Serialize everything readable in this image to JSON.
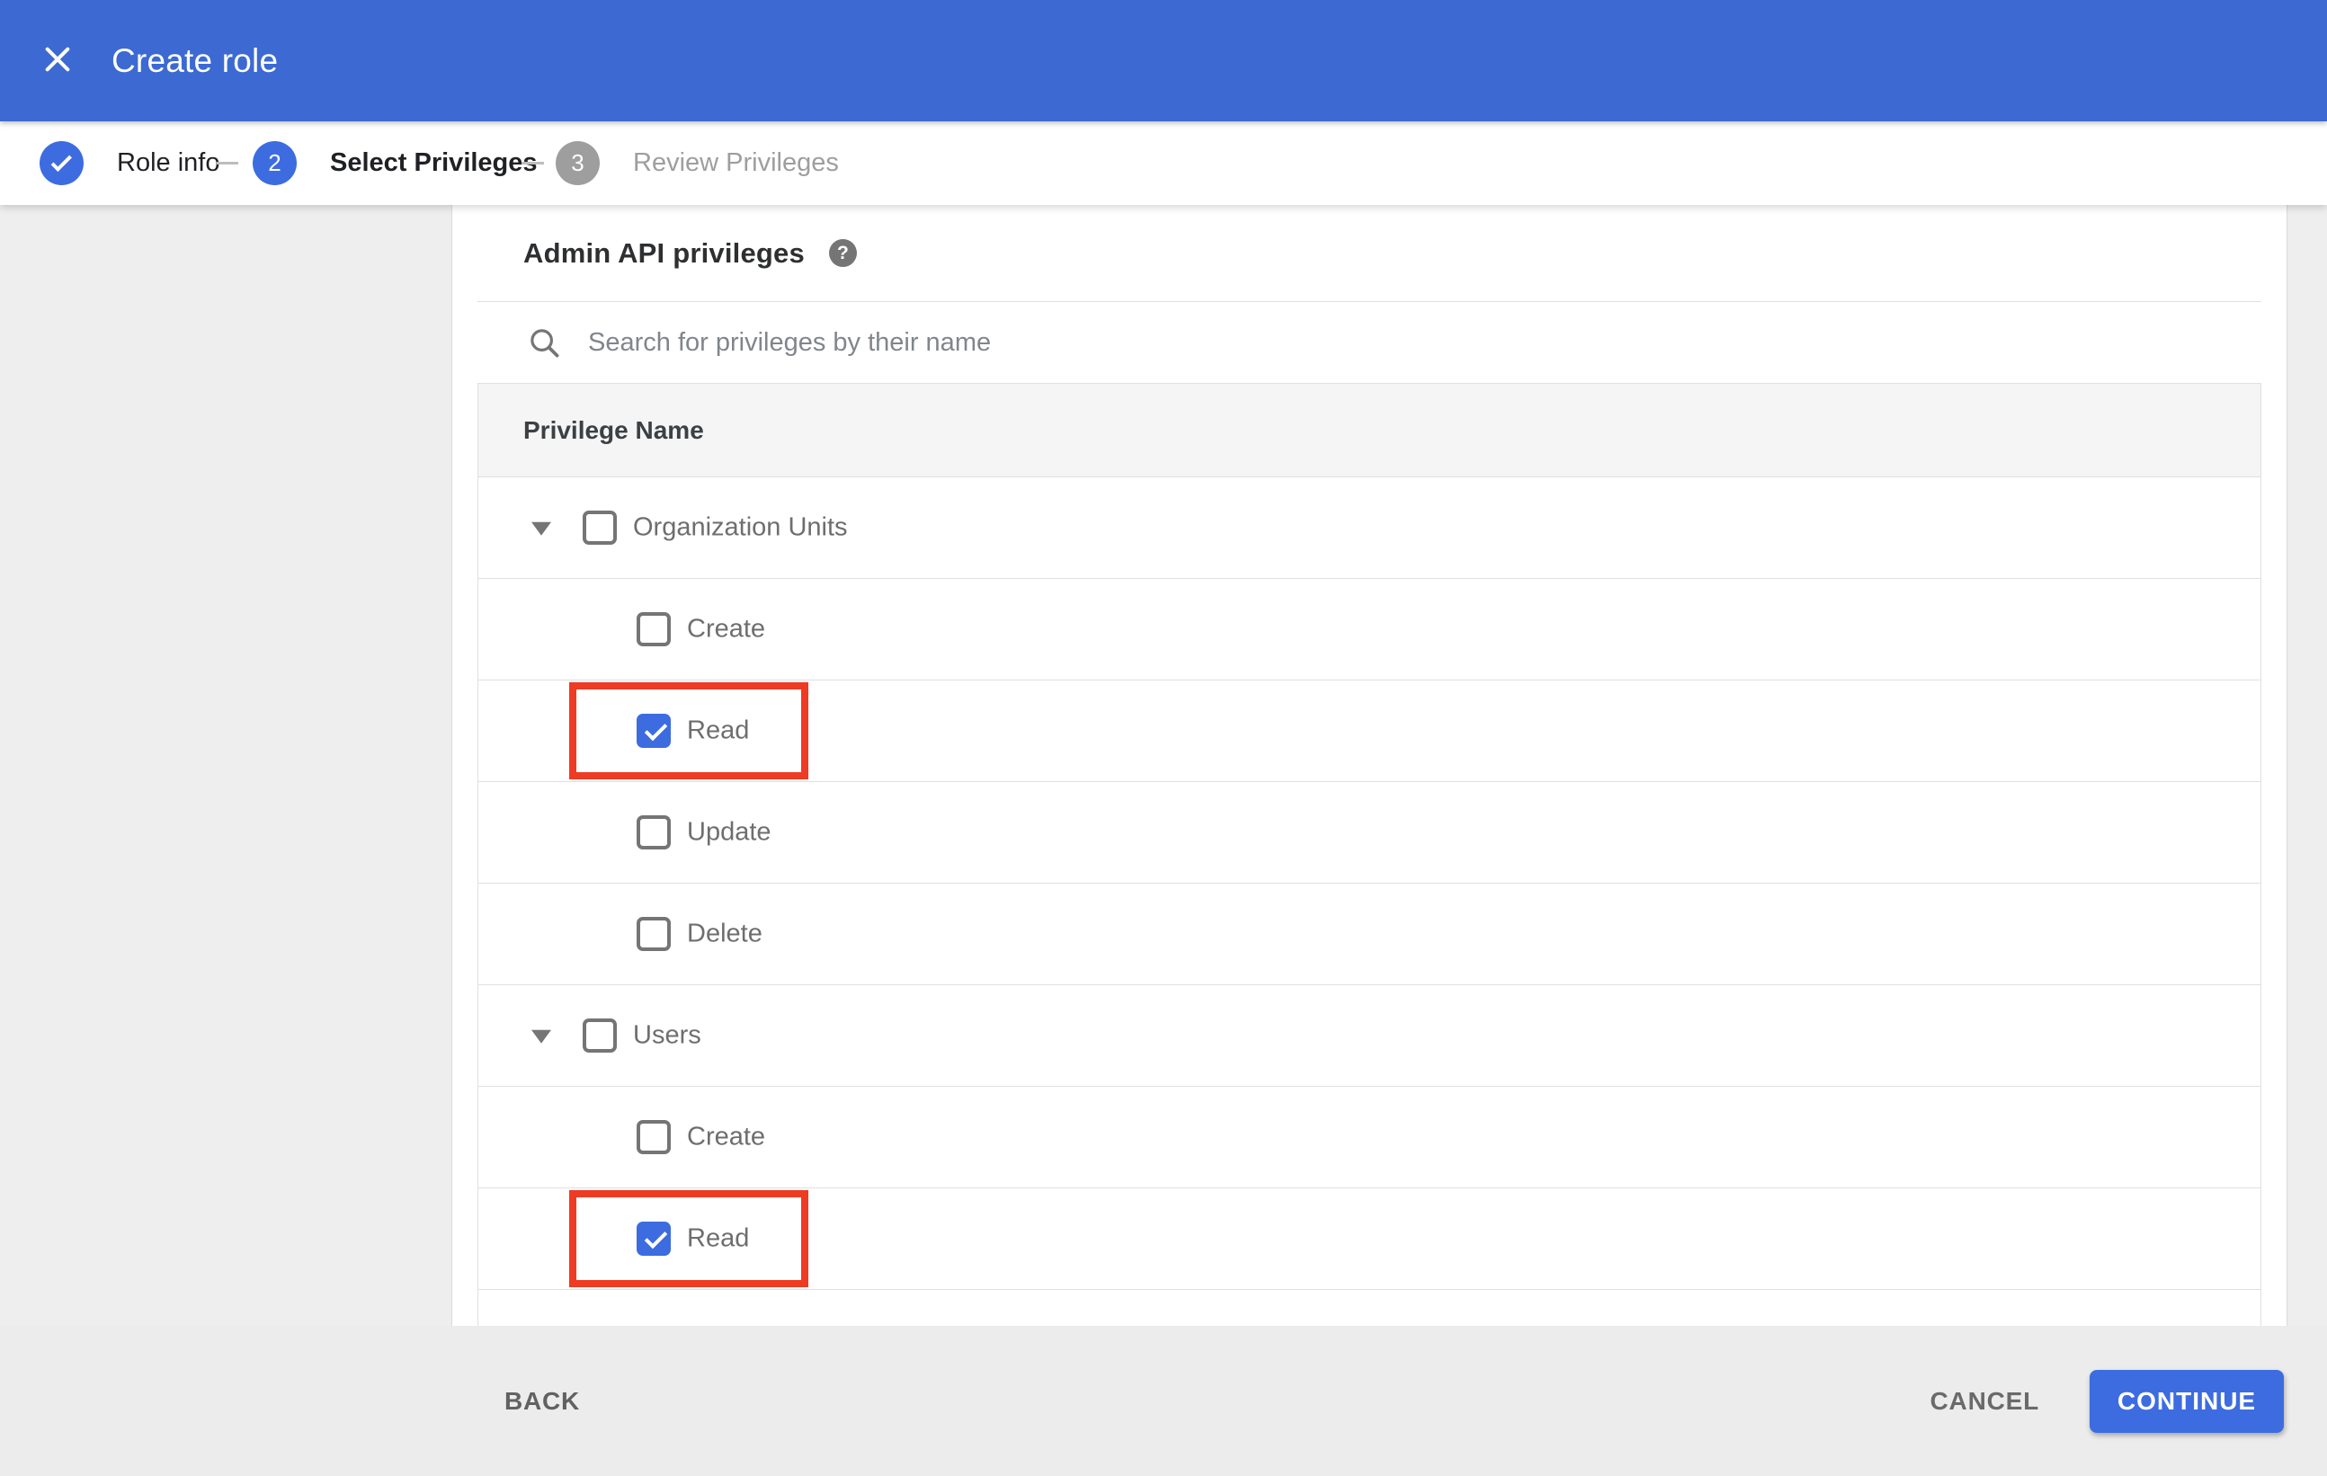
{
  "colors": {
    "header_blue": "#3c6ad2",
    "accent_blue": "#3d6ce0",
    "annotation_red": "#ee3b23",
    "page_gray": "#eeeeee",
    "footer_gray": "#ececec",
    "table_header_gray": "#f5f5f5",
    "border_gray": "#e0e0e0",
    "text_dark": "#202124",
    "text_gray": "#6e6e6e",
    "text_muted": "#9e9e9e"
  },
  "app_bar": {
    "title": "Create role",
    "close_icon": "close-x-icon"
  },
  "stepper": {
    "steps": [
      {
        "label": "Role info",
        "state": "completed",
        "badge": "check"
      },
      {
        "label": "Select Privileges",
        "state": "active",
        "badge": "2"
      },
      {
        "label": "Review Privileges",
        "state": "upcoming",
        "badge": "3"
      }
    ]
  },
  "panel": {
    "heading": "Admin API privileges",
    "help_icon": "question-mark-icon",
    "search": {
      "placeholder": "Search for privileges by their name",
      "icon": "magnifier-icon",
      "value": ""
    }
  },
  "table": {
    "header": "Privilege Name",
    "rows": [
      {
        "label": "Organization Units",
        "level": "parent",
        "checked": false,
        "expanded": true,
        "annotated": false
      },
      {
        "label": "Create",
        "level": "child",
        "checked": false,
        "annotated": false
      },
      {
        "label": "Read",
        "level": "child",
        "checked": true,
        "annotated": true
      },
      {
        "label": "Update",
        "level": "child",
        "checked": false,
        "annotated": false
      },
      {
        "label": "Delete",
        "level": "child",
        "checked": false,
        "annotated": false
      },
      {
        "label": "Users",
        "level": "parent",
        "checked": false,
        "expanded": true,
        "annotated": false
      },
      {
        "label": "Create",
        "level": "child",
        "checked": false,
        "annotated": false
      },
      {
        "label": "Read",
        "level": "child",
        "checked": true,
        "annotated": true
      }
    ]
  },
  "footer": {
    "back_label": "BACK",
    "cancel_label": "CANCEL",
    "continue_label": "CONTINUE"
  }
}
